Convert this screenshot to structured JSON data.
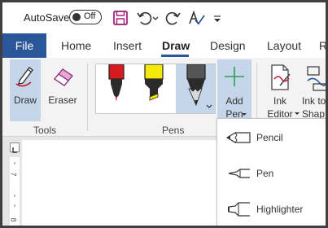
{
  "titlebar": {
    "autosave_label": "AutoSave",
    "autosave_state": "Off",
    "icons": [
      "save-icon",
      "undo-icon",
      "redo-icon",
      "spellcheck-icon",
      "customize-qat-icon"
    ]
  },
  "tabs": {
    "file": "File",
    "home": "Home",
    "insert": "Insert",
    "draw": "Draw",
    "design": "Design",
    "layout": "Layout",
    "references": "R"
  },
  "ribbon": {
    "tools": {
      "draw": "Draw",
      "eraser": "Eraser",
      "group_label": "Tools"
    },
    "pens": {
      "group_label": "Pens",
      "items": [
        "red-pen",
        "yellow-highlighter",
        "black-pencil"
      ]
    },
    "add_pen": {
      "line1": "Add",
      "line2": "Pen"
    },
    "ink_editor": {
      "line1": "Ink",
      "line2": "Editor"
    },
    "ink_to_shape": {
      "line1": "Ink to",
      "line2": "Shap"
    }
  },
  "ruler": {
    "labels": [
      "7",
      "8"
    ]
  },
  "add_pen_menu": {
    "items": [
      {
        "label": "Pencil",
        "icon": "pencil-icon"
      },
      {
        "label": "Pen",
        "icon": "pen-icon"
      },
      {
        "label": "Highlighter",
        "icon": "highlighter-icon"
      }
    ]
  },
  "colors": {
    "brand": "#2b579a",
    "selected": "#c5d5ea",
    "save_icon": "#a4257f",
    "add_pen_plus": "#2e9e57"
  }
}
